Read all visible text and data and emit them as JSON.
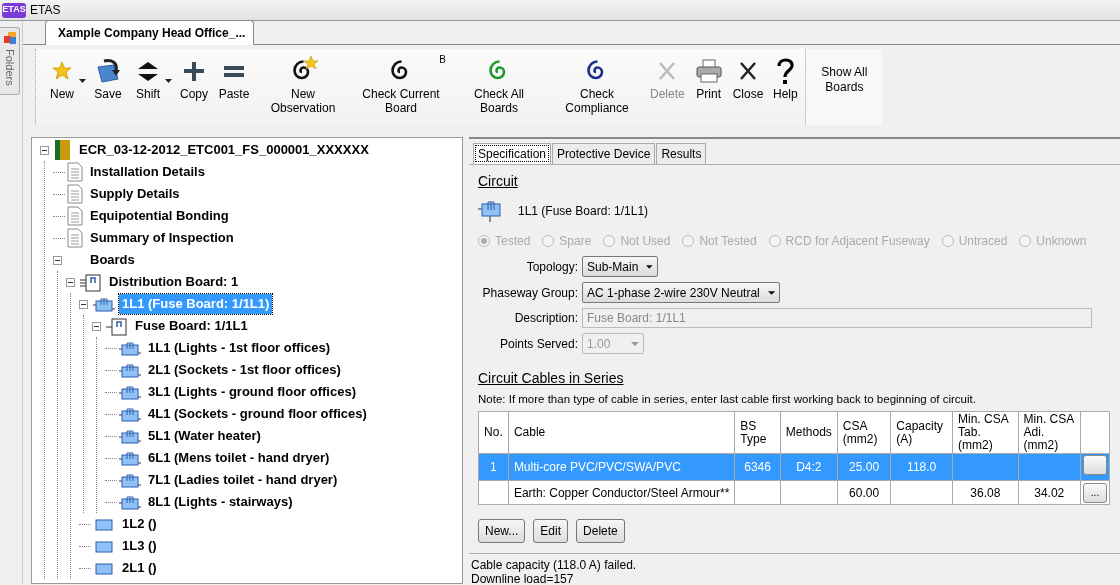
{
  "window": {
    "icon_text": "ETAS",
    "title": "ETAS"
  },
  "side_panel": {
    "label": "Folders"
  },
  "document_tabs": [
    {
      "label": "Xample Company Head Office_...",
      "selected": true
    }
  ],
  "toolbar": {
    "buttons": [
      {
        "kind": "new",
        "label": "New",
        "dropdown": true,
        "disabled": false
      },
      {
        "kind": "save",
        "label": "Save",
        "dropdown": false,
        "disabled": false
      },
      {
        "kind": "shift",
        "label": "Shift",
        "dropdown": true,
        "disabled": false
      },
      {
        "kind": "copy",
        "label": "Copy",
        "dropdown": false,
        "disabled": false
      },
      {
        "kind": "paste",
        "label": "Paste",
        "dropdown": false,
        "disabled": false
      },
      {
        "kind": "observation",
        "label": "New Observation",
        "dropdown": false,
        "disabled": false
      },
      {
        "kind": "check_current",
        "label": "Check Current Board",
        "badge": "B",
        "dropdown": false,
        "disabled": false
      },
      {
        "kind": "check_all",
        "label": "Check All Boards",
        "dropdown": false,
        "disabled": false
      },
      {
        "kind": "compliance",
        "label": "Check Compliance",
        "dropdown": false,
        "disabled": false
      },
      {
        "kind": "delete",
        "label": "Delete",
        "dropdown": false,
        "disabled": true
      },
      {
        "kind": "print",
        "label": "Print",
        "dropdown": false,
        "disabled": false
      },
      {
        "kind": "close",
        "label": "Close",
        "dropdown": false,
        "disabled": false
      },
      {
        "kind": "help",
        "label": "Help",
        "dropdown": false,
        "disabled": false
      }
    ],
    "extra_button": {
      "label": "Show All Boards"
    }
  },
  "tree": [
    {
      "label": "ECR_03-12-2012_ETC001_FS_000001_XXXXXX",
      "kind": "installation",
      "expanded": true,
      "selected": false,
      "children": [
        {
          "label": "Installation Details",
          "kind": "document",
          "selected": false
        },
        {
          "label": "Supply Details",
          "kind": "document",
          "selected": false
        },
        {
          "label": "Equipotential Bonding",
          "kind": "document",
          "selected": false
        },
        {
          "label": "Summary of Inspection",
          "kind": "document",
          "selected": false
        },
        {
          "label": "Boards",
          "kind": "folder",
          "expanded": true,
          "selected": false,
          "children": [
            {
              "label": "Distribution Board: 1",
              "kind": "distribution",
              "expanded": true,
              "selected": false,
              "children": [
                {
                  "label": "1L1 (Fuse Board: 1/1L1)",
                  "kind": "circuit",
                  "expanded": true,
                  "selected": true,
                  "children": [
                    {
                      "label": "Fuse Board: 1/1L1",
                      "kind": "board",
                      "expanded": true,
                      "selected": false,
                      "children": [
                        {
                          "label": "1L1 (Lights - 1st floor offices)",
                          "kind": "circuit",
                          "selected": false
                        },
                        {
                          "label": "2L1 (Sockets - 1st floor offices)",
                          "kind": "circuit",
                          "selected": false
                        },
                        {
                          "label": "3L1 (Lights - ground floor offices)",
                          "kind": "circuit",
                          "selected": false
                        },
                        {
                          "label": "4L1 (Sockets - ground floor offices)",
                          "kind": "circuit",
                          "selected": false
                        },
                        {
                          "label": "5L1 (Water heater)",
                          "kind": "circuit",
                          "selected": false
                        },
                        {
                          "label": "6L1 (Mens toilet - hand dryer)",
                          "kind": "circuit",
                          "selected": false
                        },
                        {
                          "label": "7L1 (Ladies toilet - hand dryer)",
                          "kind": "circuit",
                          "selected": false
                        },
                        {
                          "label": "8L1 (Lights - stairways)",
                          "kind": "circuit",
                          "selected": false
                        }
                      ]
                    }
                  ]
                },
                {
                  "label": "1L2 ()",
                  "kind": "empty_circuit",
                  "selected": false
                },
                {
                  "label": "1L3 ()",
                  "kind": "empty_circuit",
                  "selected": false
                },
                {
                  "label": "2L1 ()",
                  "kind": "empty_circuit",
                  "selected": false
                }
              ]
            }
          ]
        }
      ]
    }
  ],
  "detail_tabs": [
    {
      "label": "Specification",
      "selected": true
    },
    {
      "label": "Protective Device",
      "selected": false
    },
    {
      "label": "Results",
      "selected": false
    }
  ],
  "circuit": {
    "heading": "Circuit",
    "name": "1L1 (Fuse Board: 1/1L1)",
    "status_disabled": true,
    "status_options": [
      {
        "label": "Tested",
        "selected": true
      },
      {
        "label": "Spare",
        "selected": false
      },
      {
        "label": "Not Used",
        "selected": false
      },
      {
        "label": "Not Tested",
        "selected": false
      },
      {
        "label": "RCD for Adjacent Fuseway",
        "selected": false
      },
      {
        "label": "Untraced",
        "selected": false
      },
      {
        "label": "Unknown",
        "selected": false
      }
    ],
    "topology": {
      "label": "Topology:",
      "value": "Sub-Main"
    },
    "phaseway_group": {
      "label": "Phaseway Group:",
      "value": "AC 1-phase 2-wire 230V Neutral"
    },
    "description": {
      "label": "Description:",
      "value": "Fuse Board: 1/1L1",
      "disabled": true
    },
    "points_served": {
      "label": "Points Served:",
      "value": "1.00",
      "disabled": true
    }
  },
  "cables": {
    "heading": "Circuit Cables in Series",
    "note": "Note: If more than type of cable in series, enter last cable first working back to beginning of circuit.",
    "columns": [
      "No.",
      "Cable",
      "BS Type",
      "Methods",
      "CSA (mm2)",
      "Capacity (A)",
      "Min. CSA Tab. (mm2)",
      "Min. CSA Adi. (mm2)"
    ],
    "rows": [
      {
        "selected": true,
        "cells": [
          "1",
          "Multi-core PVC/PVC/SWA/PVC",
          "6346",
          "D4:2",
          "25.00",
          "118.0",
          "",
          ""
        ],
        "action_label": ""
      },
      {
        "selected": false,
        "cells": [
          "",
          "Earth: Copper Conductor/Steel Armour**",
          "",
          "",
          "60.00",
          "",
          "36.08",
          "34.02"
        ],
        "action_label": "..."
      }
    ],
    "buttons": [
      "New...",
      "Edit",
      "Delete"
    ]
  },
  "messages": [
    "Cable capacity (118.0 A) failed.",
    "Downline load=157"
  ]
}
